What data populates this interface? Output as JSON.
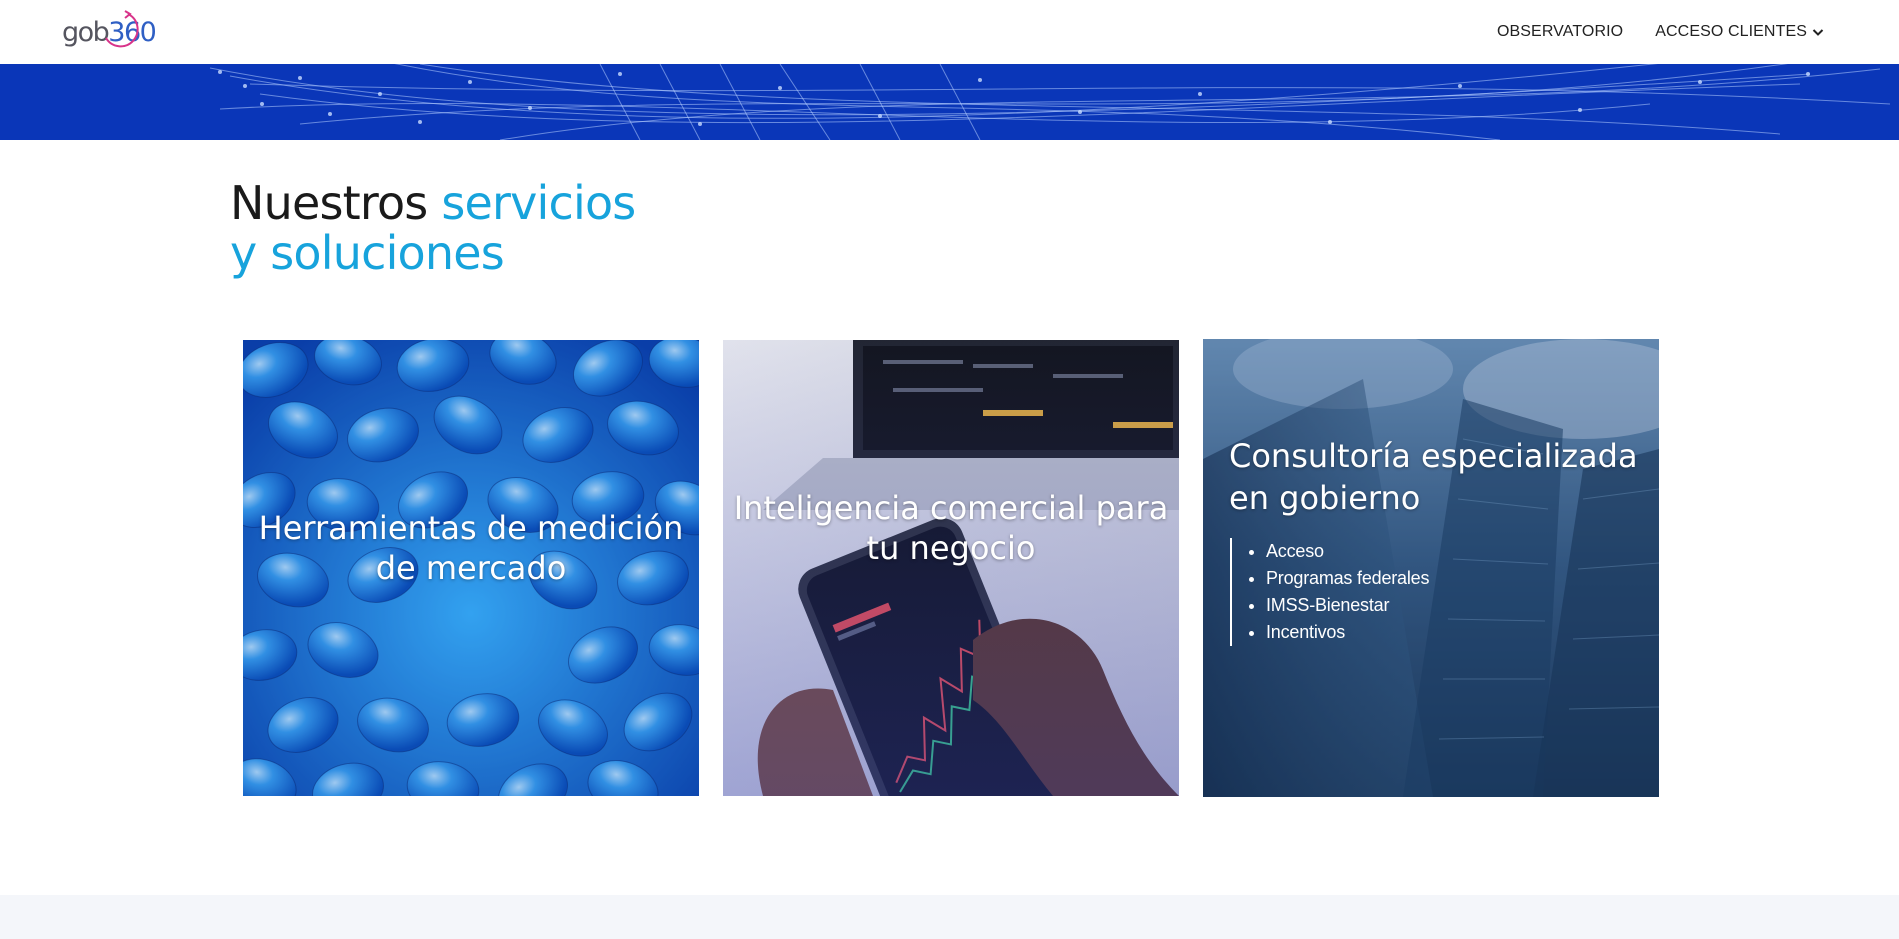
{
  "header": {
    "logo": {
      "text_main": "gob",
      "text_num": "360",
      "alt": "gob360"
    },
    "nav": [
      {
        "label": "OBSERVATORIO"
      },
      {
        "label": "ACCESO CLIENTES",
        "icon": "chevron-down-icon"
      }
    ]
  },
  "section": {
    "title_dark": "Nuestros",
    "title_accent_1": "servicios",
    "title_accent_2": "y soluciones"
  },
  "cards": [
    {
      "title": "Herramientas de medición de mercado",
      "image": "blue-capsules-image"
    },
    {
      "title": "Inteligencia comercial para tu negocio",
      "image": "hands-phone-stock-chart-image"
    },
    {
      "title": "Consultoría especializada en gobierno",
      "image": "glass-building-image",
      "items": [
        "Acceso",
        "Programas federales",
        "IMSS-Bienestar",
        "Incentivos"
      ]
    }
  ],
  "colors": {
    "accent": "#17a3dc",
    "banner": "#0a36b8",
    "text_dark": "#1a1a1a",
    "logo_blue": "#2f5fc4",
    "logo_magenta": "#d8348a"
  }
}
